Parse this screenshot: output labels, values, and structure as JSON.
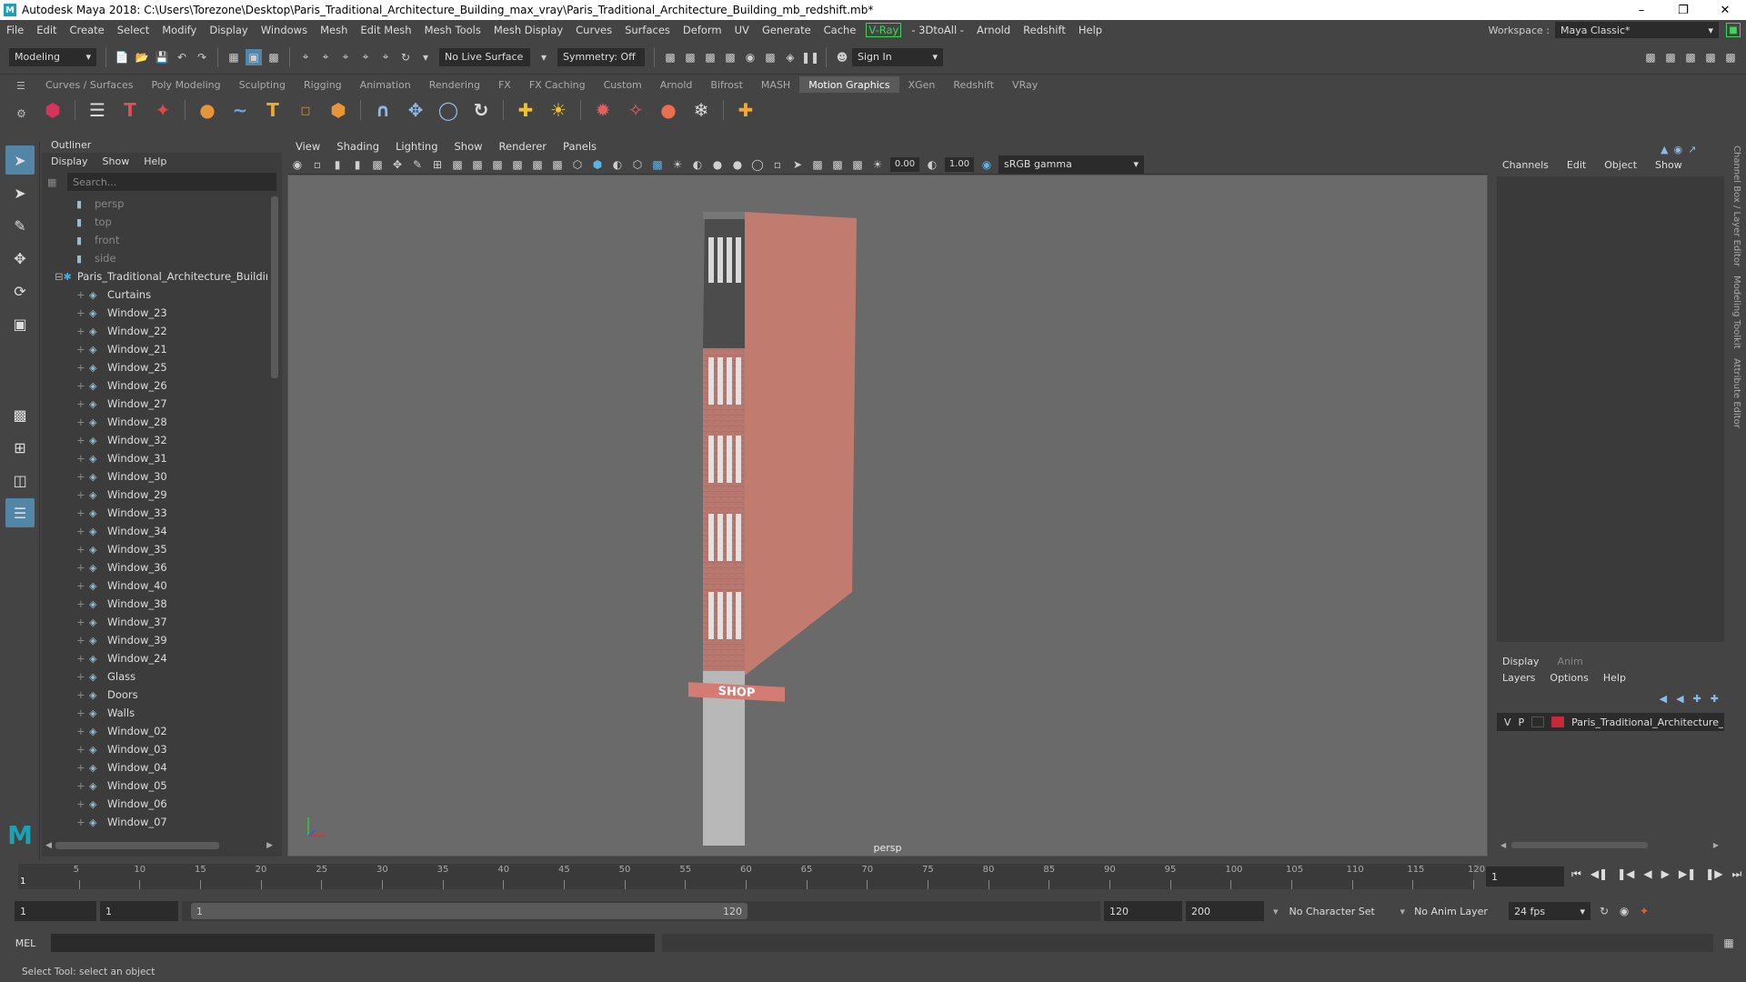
{
  "title": "Autodesk Maya 2018: C:\\Users\\Torezone\\Desktop\\Paris_Traditional_Architecture_Building_max_vray\\Paris_Traditional_Architecture_Building_mb_redshift.mb*",
  "menu": [
    "File",
    "Edit",
    "Create",
    "Select",
    "Modify",
    "Display",
    "Windows",
    "Mesh",
    "Edit Mesh",
    "Mesh Tools",
    "Mesh Display",
    "Curves",
    "Surfaces",
    "Deform",
    "UV",
    "Generate",
    "Cache"
  ],
  "menu_vray": "V-Ray",
  "menu_tail": [
    "- 3DtoAll -",
    "Arnold",
    "Redshift",
    "Help"
  ],
  "workspace": {
    "label": "Workspace :",
    "value": "Maya Classic*"
  },
  "status": {
    "mode": "Modeling",
    "live_surface": "No Live Surface",
    "symmetry": "Symmetry: Off",
    "sign_in": "Sign In"
  },
  "shelf_tabs": [
    "Curves / Surfaces",
    "Poly Modeling",
    "Sculpting",
    "Rigging",
    "Animation",
    "Rendering",
    "FX",
    "FX Caching",
    "Custom",
    "Arnold",
    "Bifrost",
    "MASH",
    "Motion Graphics",
    "XGen",
    "Redshift",
    "VRay"
  ],
  "shelf_active": "Motion Graphics",
  "outliner": {
    "title": "Outliner",
    "menu": [
      "Display",
      "Show",
      "Help"
    ],
    "search": "Search...",
    "cameras": [
      "persp",
      "top",
      "front",
      "side"
    ],
    "root": "Paris_Traditional_Architecture_Buildir",
    "children": [
      "Curtains",
      "Window_23",
      "Window_22",
      "Window_21",
      "Window_25",
      "Window_26",
      "Window_27",
      "Window_28",
      "Window_32",
      "Window_31",
      "Window_30",
      "Window_29",
      "Window_33",
      "Window_34",
      "Window_35",
      "Window_36",
      "Window_40",
      "Window_38",
      "Window_37",
      "Window_39",
      "Window_24",
      "Glass",
      "Doors",
      "Walls",
      "Window_02",
      "Window_03",
      "Window_04",
      "Window_05",
      "Window_06",
      "Window_07"
    ]
  },
  "viewport": {
    "menu": [
      "View",
      "Shading",
      "Lighting",
      "Show",
      "Renderer",
      "Panels"
    ],
    "val1": "0.00",
    "val2": "1.00",
    "colorspace": "sRGB gamma",
    "camera_label": "persp",
    "shop_sign": "SHOP"
  },
  "channel_box": {
    "menu": [
      "Channels",
      "Edit",
      "Object",
      "Show"
    ]
  },
  "layer_editor": {
    "tabs": [
      "Display",
      "Anim"
    ],
    "menu": [
      "Layers",
      "Options",
      "Help"
    ],
    "layer": {
      "v": "V",
      "p": "P",
      "name": "Paris_Traditional_Architecture_",
      "color": "#c8283a"
    }
  },
  "side_tabs": [
    "Channel Box / Layer Editor",
    "Modeling Toolkit",
    "Attribute Editor"
  ],
  "timeline": {
    "ticks": [
      "5",
      "10",
      "15",
      "20",
      "25",
      "30",
      "35",
      "40",
      "45",
      "50",
      "55",
      "60",
      "65",
      "70",
      "75",
      "80",
      "85",
      "90",
      "95",
      "100",
      "105",
      "110",
      "115",
      "120"
    ],
    "current_label": "1",
    "current": "1"
  },
  "range": {
    "start": "1",
    "inner_start": "1",
    "slider_start": "1",
    "slider_end": "120",
    "end": "120",
    "max": "200",
    "char_set": "No Character Set",
    "anim_layer": "No Anim Layer",
    "fps": "24 fps"
  },
  "cmd": {
    "label": "MEL"
  },
  "help": "Select Tool: select an object"
}
